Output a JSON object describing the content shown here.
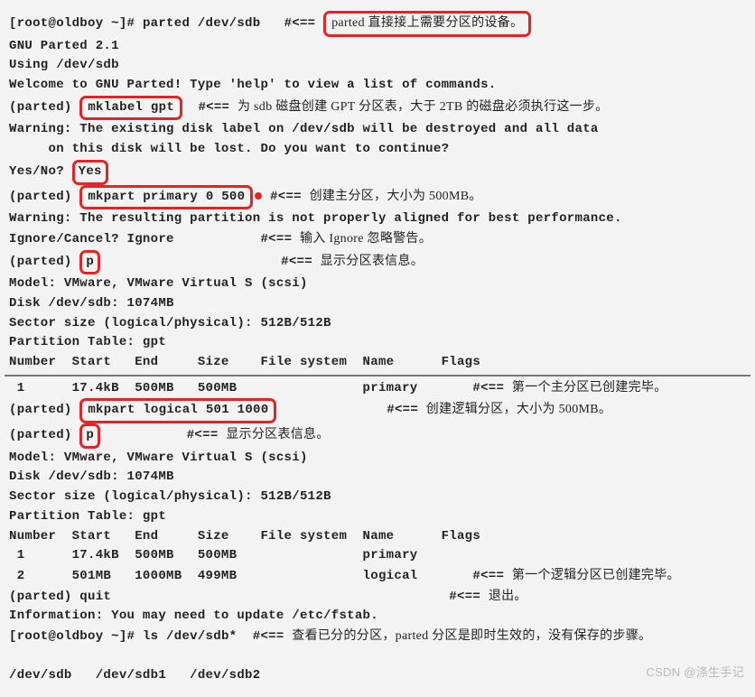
{
  "prompt": "[root@oldboy ~]# ",
  "cmd": {
    "parted": "parted /dev/sdb",
    "ls": "ls /dev/sdb*"
  },
  "arrow": "#<== ",
  "ann": {
    "dev": "parted 直接接上需要分区的设备。",
    "sdb": "为 sdb 磁盘创建 GPT 分区表，大于 2TB 的磁盘必须执行这一步。",
    "primary": "创建主分区，大小为 500MB。",
    "ignore": "输入 Ignore 忽略警告。",
    "show1": "显示分区表信息。",
    "firstp": "第一个主分区已创建完毕。",
    "logical": "创建逻辑分区，大小为 500MB。",
    "show2": "显示分区表信息。",
    "firstl": "第一个逻辑分区已创建完毕。",
    "quit": "退出。",
    "ls": "查看已分的分区，parted 分区是即时生效的，没有保存的步骤。"
  },
  "out": {
    "gnu": "GNU Parted 2.1",
    "using": "Using /dev/sdb",
    "welcome": "Welcome to GNU Parted! Type 'help' to view a list of commands.",
    "warn1a": "Warning: The existing disk label on /dev/sdb will be destroyed and all data",
    "warn1b": "     on this disk will be lost. Do you want to continue?",
    "yesno": "Yes/No? ",
    "warn2": "Warning: The resulting partition is not properly aligned for best performance.",
    "ic": "Ignore/Cancel? ",
    "ignoreA": "Ignore",
    "model": "Model: VMware, VMware Virtual S (scsi)",
    "disk": "Disk /dev/sdb: 1074MB",
    "sector": "Sector size (logical/physical): 512B/512B",
    "ptable": "Partition Table: gpt",
    "header": "Number  Start   End     Size    File system  Name      Flags",
    "row1a": " 1      17.4kB  500MB   500MB                primary",
    "row1b": " 1      17.4kB  500MB   500MB                primary",
    "row2": " 2      501MB   1000MB  499MB                logical",
    "quit": "(parted) quit",
    "info": "Information: You may need to update /etc/fstab.",
    "lsout": "/dev/sdb   /dev/sdb1   /dev/sdb2"
  },
  "in": {
    "pparted": "(parted) ",
    "mklabel": "mklabel gpt",
    "yes": "Yes",
    "mkpart1": "mkpart primary 0 500",
    "p": "p",
    "mkpart2": "mkpart logical 501 1000"
  },
  "watermark": "CSDN @涤生手记"
}
